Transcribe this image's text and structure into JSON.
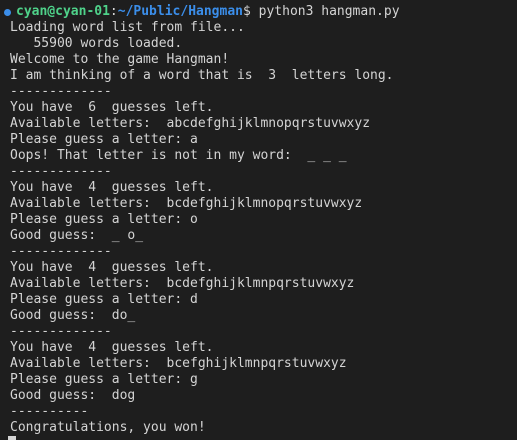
{
  "colors": {
    "background": "#1e1e1e",
    "text": "#d4d4d4",
    "prompt_user": "#4fd28a",
    "prompt_path": "#3b8eea",
    "status_dot": "#3b8eea"
  },
  "prompt": {
    "status_icon": "circle-icon",
    "user_host": "cyan@cyan-01",
    "separator": ":",
    "path": "~/Public/Hangman",
    "symbol": "$",
    "command": " python3 hangman.py"
  },
  "output": [
    "Loading word list from file...",
    "   55900 words loaded.",
    "Welcome to the game Hangman!",
    "I am thinking of a word that is  3  letters long.",
    "-------------",
    "You have  6  guesses left.",
    "Available letters:  abcdefghijklmnopqrstuvwxyz",
    "Please guess a letter: a",
    "Oops! That letter is not in my word:  _ _ _",
    "-------------",
    "You have  4  guesses left.",
    "Available letters:  bcdefghijklmnopqrstuvwxyz",
    "Please guess a letter: o",
    "Good guess:  _ o_",
    "-------------",
    "You have  4  guesses left.",
    "Available letters:  bcdefghijklmnpqrstuvwxyz",
    "Please guess a letter: d",
    "Good guess:  do_",
    "-------------",
    "You have  4  guesses left.",
    "Available letters:  bcefghijklmnpqrstuvwxyz",
    "Please guess a letter: g",
    "Good guess:  dog",
    "----------",
    "Congratulations, you won!"
  ]
}
